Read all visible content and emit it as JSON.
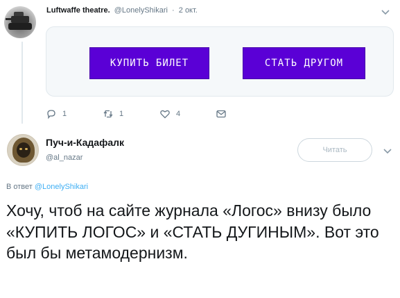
{
  "parent_tweet": {
    "author_name": "Luftwaffe theatre.",
    "author_handle": "@LonelyShikari",
    "separator": "·",
    "date": "2 окт.",
    "card": {
      "buy_button_label": "КУПИТЬ БИЛЕТ",
      "friend_button_label": "СТАТЬ ДРУГОМ",
      "button_color": "#5a00d6"
    },
    "actions": {
      "reply_count": "1",
      "retweet_count": "1",
      "like_count": "4",
      "icons": [
        "reply-icon",
        "retweet-icon",
        "like-icon",
        "dm-icon"
      ]
    }
  },
  "reply_tweet": {
    "author_name": "Пуч-и-Кадафалк",
    "author_handle": "@al_nazar",
    "follow_button_label": "Читать",
    "reply_prefix": "В ответ",
    "reply_to_handle": "@LonelyShikari",
    "text": "Хочу, чтоб на сайте журнала «Логос» внизу было «КУПИТЬ ЛОГОС» и «СТАТЬ ДУГИНЫМ». Вот это был бы метамодернизм."
  },
  "colors": {
    "text_primary": "#14171a",
    "text_secondary": "#657786",
    "link": "#1da1f2",
    "border": "#e1e8ed"
  }
}
